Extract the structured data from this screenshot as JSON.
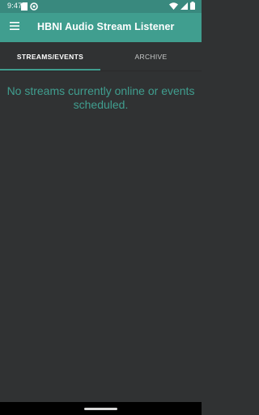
{
  "status_bar": {
    "time": "9:47",
    "notification_icons": [
      "sd-card-icon",
      "circle-notification-icon"
    ],
    "right_icons": [
      "wifi-icon",
      "signal-icon",
      "battery-icon"
    ]
  },
  "app_bar": {
    "title": "HBNI Audio Stream Listener",
    "menu_icon": "hamburger-menu-icon"
  },
  "tabs": [
    {
      "label": "STREAMS/EVENTS",
      "selected": true
    },
    {
      "label": "ARCHIVE",
      "selected": false
    }
  ],
  "content": {
    "empty_message": "No streams currently online or events scheduled."
  },
  "colors": {
    "status_bar": "#39897e",
    "app_bar": "#409e8f",
    "background": "#303233",
    "accent": "#409e8f",
    "navigation_bar": "#000000"
  }
}
